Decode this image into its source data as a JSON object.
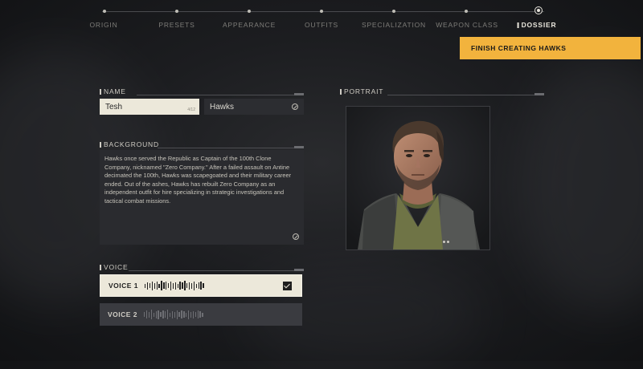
{
  "nav": {
    "tabs": [
      {
        "label": "ORIGIN",
        "active": false
      },
      {
        "label": "PRESETS",
        "active": false
      },
      {
        "label": "APPEARANCE",
        "active": false
      },
      {
        "label": "OUTFITS",
        "active": false
      },
      {
        "label": "SPECIALIZATION",
        "active": false
      },
      {
        "label": "WEAPON CLASS",
        "active": false
      },
      {
        "label": "DOSSIER",
        "active": true
      }
    ]
  },
  "finish_button": {
    "label": "FINISH CREATING HAWKS"
  },
  "name": {
    "heading": "NAME",
    "first_name": "Tesh",
    "first_count": "4/12",
    "last_name": "Hawks"
  },
  "background": {
    "heading": "BACKGROUND",
    "text": "Hawks once served the Republic as Captain of the 100th Clone Company, nicknamed \"Zero Company.\" After a failed assault on Antine decimated the 100th, Hawks was scapegoated and their military career ended. Out of the ashes, Hawks has rebuilt Zero Company as an independent outfit for hire specializing in strategic investigations and tactical combat missions."
  },
  "portrait": {
    "heading": "PORTRAIT"
  },
  "voice": {
    "heading": "VOICE",
    "options": [
      {
        "label": "VOICE 1",
        "selected": true
      },
      {
        "label": "VOICE 2",
        "selected": false
      }
    ]
  },
  "colors": {
    "accent": "#f2b33d",
    "selected_bg": "#ece8da",
    "panel": "#2a2b2f"
  },
  "icons": [
    "edit-icon",
    "checkbox-checked-icon",
    "waveform-icon",
    "more-options-icon"
  ]
}
